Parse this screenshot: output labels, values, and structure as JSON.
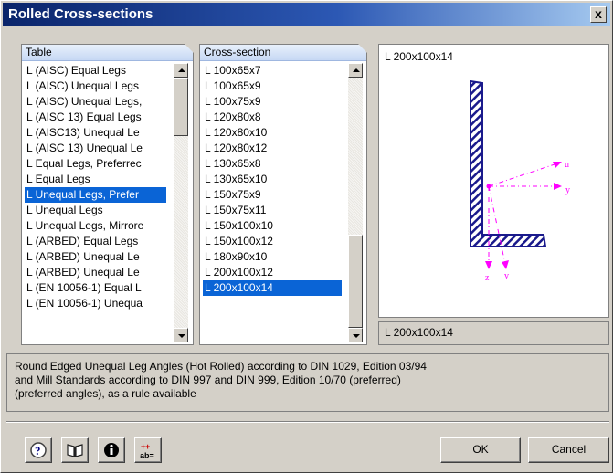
{
  "window": {
    "title": "Rolled Cross-sections",
    "close_label": "x"
  },
  "table_panel": {
    "header": "Table",
    "items": [
      "L (AISC) Equal Legs",
      "L (AISC) Unequal Legs",
      "L (AISC) Unequal Legs,",
      "L (AISC 13) Equal Legs",
      "L (AISC13) Unequal Le",
      "L (AISC 13) Unequal Le",
      "L Equal Legs, Preferrec",
      "L Equal Legs",
      "L Unequal Legs, Prefer",
      "L Unequal Legs",
      "L Unequal Legs, Mirrore",
      "L (ARBED) Equal Legs",
      "L (ARBED) Unequal Le",
      "L (ARBED) Unequal Le",
      "L (EN 10056-1) Equal L",
      "L (EN 10056-1) Unequa"
    ],
    "selected_index": 8
  },
  "section_panel": {
    "header": "Cross-section",
    "items": [
      "L 100x65x7",
      "L 100x65x9",
      "L 100x75x9",
      "L 120x80x8",
      "L 120x80x10",
      "L 120x80x12",
      "L 130x65x8",
      "L 130x65x10",
      "L 150x75x9",
      "L 150x75x11",
      "L 150x100x10",
      "L 150x100x12",
      "L 180x90x10",
      "L 200x100x12",
      "L 200x100x14"
    ],
    "selected_index": 14
  },
  "preview": {
    "label": "L 200x100x14",
    "axis_labels": {
      "u": "u",
      "y": "y",
      "z": "z",
      "v": "v"
    },
    "colors": {
      "section": "#1a1a8c",
      "axes": "#ff00ff"
    }
  },
  "selected_name": "L 200x100x14",
  "description": [
    "Round Edged Unequal Leg Angles (Hot Rolled) according to DIN 1029, Edition 03/94",
    "and Mill Standards according to DIN 997 and DIN 999, Edition 10/70 (preferred)",
    "(preferred angles), as a rule available"
  ],
  "buttons": {
    "ok": "OK",
    "cancel": "Cancel"
  },
  "icons": [
    "help-icon",
    "book-icon",
    "info-icon",
    "units-icon"
  ]
}
